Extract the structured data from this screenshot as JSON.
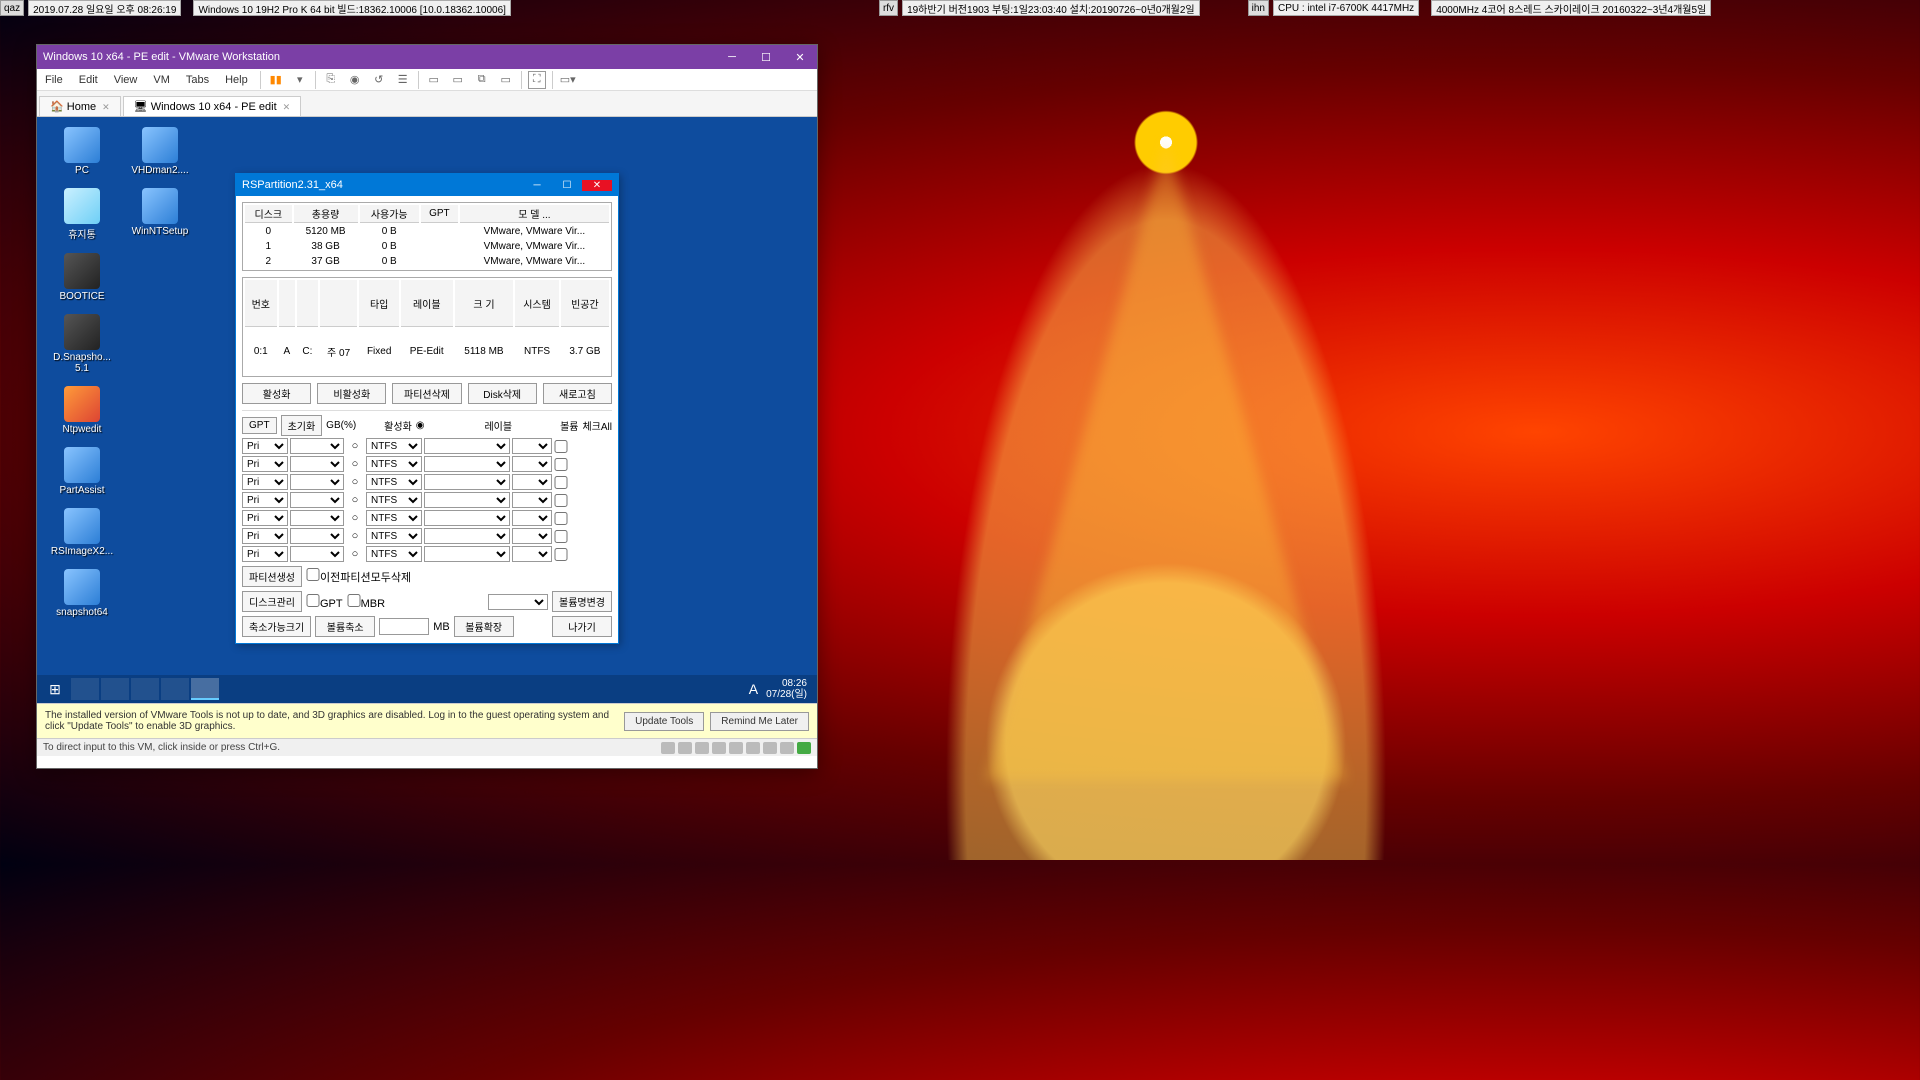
{
  "top": {
    "qaz_lbl": "qaz",
    "qaz": "2019.07.28 일요일 오후 08:26:19",
    "win": "Windows 10 19H2 Pro K 64 bit 빌드:18362.10006 [10.0.18362.10006]",
    "rfv_lbl": "rfv",
    "rfv": "19하반기 버전1903 부팅:1일23:03:40 설치:20190726~0년0개월2일",
    "ihn_lbl": "ihn",
    "ihn": "CPU : intel i7-6700K 4417MHz",
    "clk": "4000MHz 4코어 8스레드 스카이레이크 20160322~3년4개월5일"
  },
  "vm": {
    "title": "Windows 10 x64 - PE edit - VMware Workstation",
    "menu": [
      "File",
      "Edit",
      "View",
      "VM",
      "Tabs",
      "Help"
    ],
    "tabs": {
      "home": "Home",
      "active": "Windows 10 x64 - PE edit"
    },
    "notif": "The installed version of VMware Tools is not up to date, and 3D graphics are disabled. Log in to the guest operating system and click \"Update Tools\" to enable 3D graphics.",
    "update": "Update Tools",
    "remind": "Remind Me Later",
    "status": "To direct input to this VM, click inside or press Ctrl+G."
  },
  "desk": [
    {
      "n": "PC",
      "c": ""
    },
    {
      "n": "VHDman2....",
      "c": ""
    },
    {
      "n": "휴지통",
      "c": "bin"
    },
    {
      "n": "WinNTSetup",
      "c": ""
    },
    {
      "n": "BOOTICE",
      "c": "dark"
    },
    {
      "n": "",
      "c": ""
    },
    {
      "n": "D.Snapsho...\n5.1",
      "c": "dark"
    },
    {
      "n": "",
      "c": ""
    },
    {
      "n": "Ntpwedit",
      "c": "red"
    },
    {
      "n": "",
      "c": ""
    },
    {
      "n": "PartAssist",
      "c": ""
    },
    {
      "n": "",
      "c": ""
    },
    {
      "n": "RSImageX2...",
      "c": ""
    },
    {
      "n": "",
      "c": ""
    },
    {
      "n": "snapshot64",
      "c": ""
    }
  ],
  "rsp": {
    "title": "RSPartition2.31_x64",
    "dh": [
      "디스크",
      "총용량",
      "사용가능",
      "GPT",
      "모   델        ..."
    ],
    "dr": [
      [
        "0",
        "5120  MB",
        "0  B",
        "",
        "VMware, VMware Vir..."
      ],
      [
        "1",
        "38  GB",
        "0  B",
        "",
        "VMware, VMware Vir..."
      ],
      [
        "2",
        "37  GB",
        "0  B",
        "",
        "VMware, VMware Vir..."
      ]
    ],
    "ph": [
      "번호",
      "",
      "",
      "",
      "타입",
      "레이블",
      "크 기",
      "시스템",
      "빈공간"
    ],
    "pr": [
      [
        "0:1",
        "A",
        "C:",
        "주   07",
        "Fixed",
        "PE-Edit",
        "5118  MB",
        "NTFS",
        "3.7  GB"
      ]
    ],
    "b1": [
      "활성화",
      "비활성화",
      "파티션삭제",
      "Disk삭제",
      "새로고침"
    ],
    "cfg_lbl": {
      "gpt": "GPT",
      "init": "초기화",
      "gbp": "GB(%)",
      "act": "활성화",
      "label": "레이블",
      "vol": "볼륨",
      "chk": "체크All"
    },
    "pri": "Pri",
    "ntfs": "NTFS",
    "b2": {
      "pcreate": "파티션생성",
      "prevdel": "이전파티션모두삭제",
      "dmanage": "디스크관리",
      "cgpt": "GPT",
      "cmbr": "MBR",
      "vrename": "볼륨명변경",
      "shrink": "축소가능크기",
      "vshrink": "볼륨축소",
      "mb": "MB",
      "vexpand": "볼륨확장",
      "exit": "나가기"
    }
  },
  "tb": {
    "time": "08:26",
    "date": "07/28(일)",
    "lang": "A"
  }
}
